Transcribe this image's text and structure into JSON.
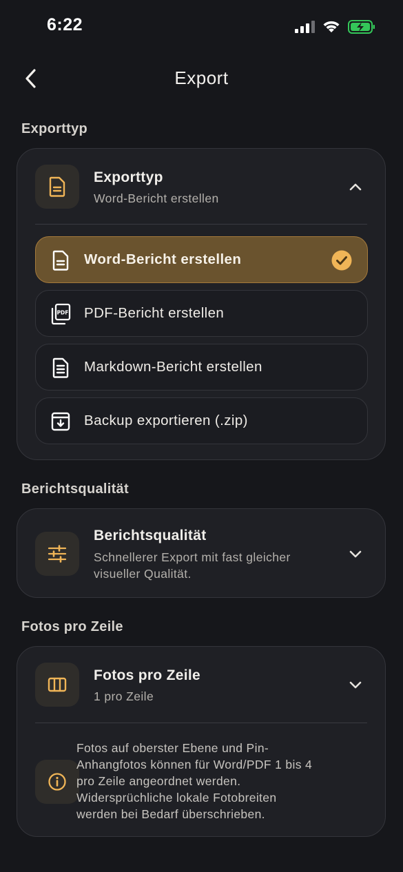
{
  "status_bar": {
    "time": "6:22"
  },
  "nav": {
    "title": "Export"
  },
  "accent_color": "#f0b557",
  "sections": {
    "export_type": {
      "label": "Exporttyp",
      "card_title": "Exporttyp",
      "card_subtitle": "Word-Bericht erstellen",
      "expanded": true,
      "options": [
        {
          "label": "Word-Bericht erstellen",
          "icon": "document-icon",
          "selected": true
        },
        {
          "label": "PDF-Bericht erstellen",
          "icon": "pdf-icon",
          "selected": false
        },
        {
          "label": "Markdown-Bericht erstellen",
          "icon": "text-document-icon",
          "selected": false
        },
        {
          "label": "Backup exportieren (.zip)",
          "icon": "archive-download-icon",
          "selected": false
        }
      ]
    },
    "report_quality": {
      "label": "Berichtsqualität",
      "card_title": "Berichtsqualität",
      "card_subtitle_line1": "Schnellerer Export mit fast gleicher",
      "card_subtitle_line2": "visueller Qualität."
    },
    "photos_per_row": {
      "label": "Fotos pro Zeile",
      "card_title": "Fotos pro Zeile",
      "card_subtitle": "1 pro Zeile",
      "info_lines": [
        "Fotos auf oberster Ebene und Pin-",
        "Anhangfotos können für Word/PDF 1 bis 4",
        "pro Zeile angeordnet werden.",
        "Widersprüchliche lokale Fotobreiten",
        "werden bei Bedarf überschrieben."
      ]
    }
  }
}
